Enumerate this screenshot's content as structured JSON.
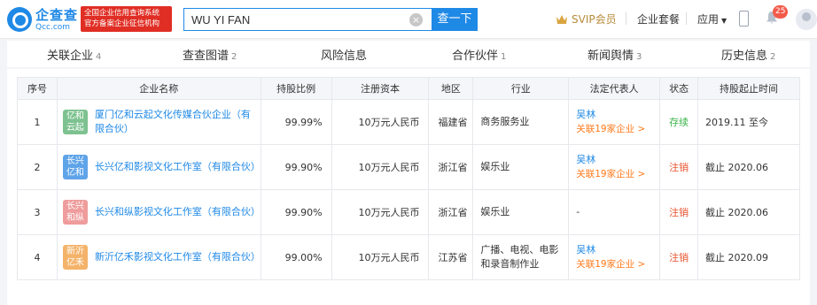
{
  "header": {
    "logo_cn": "企查查",
    "logo_en": "Qcc.com",
    "slogan_line1": "全国企业信用查询系统",
    "slogan_line2": "官方备案企业征信机构",
    "search_value": "WU YI FAN",
    "search_button": "查一下",
    "svip": "SVIP会员",
    "package": "企业套餐",
    "apps": "应用",
    "notif_count": "25"
  },
  "tabs": [
    {
      "label": "关联企业",
      "count": "4"
    },
    {
      "label": "查查图谱",
      "count": "2"
    },
    {
      "label": "风险信息",
      "count": ""
    },
    {
      "label": "合作伙伴",
      "count": "1"
    },
    {
      "label": "新闻舆情",
      "count": "3"
    },
    {
      "label": "历史信息",
      "count": "2"
    }
  ],
  "table": {
    "headers": [
      "序号",
      "企业名称",
      "持股比例",
      "注册资本",
      "地区",
      "行业",
      "法定代表人",
      "状态",
      "持股起止时间"
    ],
    "rows": [
      {
        "idx": "1",
        "logo": "亿和云起",
        "logo_l1": "亿和",
        "logo_l2": "云起",
        "logo_color": "#7dc290",
        "name": "厦门亿和云起文化传媒合伙企业（有限合伙）",
        "pct": "99.99%",
        "capital": "10万元人民币",
        "region": "福建省",
        "industry": "商务服务业",
        "rep": "吴林",
        "rep_rel": "关联19家企业 >",
        "status": "存续",
        "period": "2019.11 至今"
      },
      {
        "idx": "2",
        "logo": "长兴亿和",
        "logo_l1": "长兴",
        "logo_l2": "亿和",
        "logo_color": "#5fa4e8",
        "name": "长兴亿和影视文化工作室（有限合伙）",
        "pct": "99.90%",
        "capital": "10万元人民币",
        "region": "浙江省",
        "industry": "娱乐业",
        "rep": "吴林",
        "rep_rel": "关联19家企业 >",
        "status": "注销",
        "period": "截止 2020.06"
      },
      {
        "idx": "3",
        "logo": "长兴和纵",
        "logo_l1": "长兴",
        "logo_l2": "和纵",
        "logo_color": "#ef9c9c",
        "name": "长兴和纵影视文化工作室（有限合伙）",
        "pct": "99.90%",
        "capital": "10万元人民币",
        "region": "浙江省",
        "industry": "娱乐业",
        "rep": "-",
        "rep_rel": "",
        "status": "注销",
        "period": "截止 2020.06"
      },
      {
        "idx": "4",
        "logo": "新沂亿禾",
        "logo_l1": "新沂",
        "logo_l2": "亿禾",
        "logo_color": "#f4b36a",
        "name": "新沂亿禾影视文化工作室（有限合伙）",
        "pct": "99.00%",
        "capital": "10万元人民币",
        "region": "江苏省",
        "industry": "广播、电视、电影和录音制作业",
        "rep": "吴林",
        "rep_rel": "关联19家企业 >",
        "status": "注销",
        "period": "截止 2020.09"
      }
    ]
  },
  "colors": {
    "brand": "#1f89e6",
    "alive": "#39b44a",
    "cancelled": "#e8532e",
    "relation": "#ff7a1b"
  }
}
